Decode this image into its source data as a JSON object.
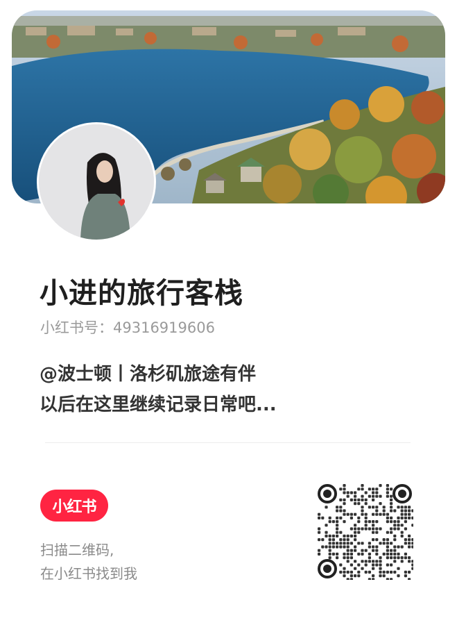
{
  "profile": {
    "name": "小进的旅行客栈",
    "id_label": "小红书号：49316919606",
    "bio_line1": "@波士顿丨洛杉矶旅途有伴",
    "bio_line2": "以后在这里继续记录日常吧..."
  },
  "footer": {
    "logo_text": "小红书",
    "scan_line1": "扫描二维码,",
    "scan_line2": "在小红书找到我"
  },
  "colors": {
    "brand": "#ff2442",
    "lake": "#1f5e8c",
    "text_primary": "#1f1f1f",
    "text_secondary": "#9a9a9a"
  },
  "icons": {
    "qr": "qr-code-icon",
    "logo": "xiaohongshu-logo"
  }
}
